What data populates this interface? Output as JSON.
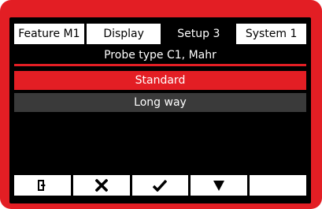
{
  "tabs": [
    {
      "label": "Feature  M1",
      "active": false
    },
    {
      "label": "Display",
      "active": false
    },
    {
      "label": "Setup 3",
      "active": true
    },
    {
      "label": "System 1",
      "active": false
    }
  ],
  "screen_title": "Probe type C1, Mahr",
  "options": [
    {
      "label": "Standard",
      "selected": true
    },
    {
      "label": "Long way",
      "selected": false
    }
  ],
  "softkeys": [
    {
      "icon": "exit-door-icon"
    },
    {
      "icon": "cross-icon"
    },
    {
      "icon": "check-icon"
    },
    {
      "icon": "down-triangle-icon"
    },
    {
      "icon": ""
    }
  ],
  "colors": {
    "accent": "#e31e24",
    "screen_bg": "#000000",
    "option_bg": "#3a3a3a",
    "tab_bg": "#ffffff"
  }
}
